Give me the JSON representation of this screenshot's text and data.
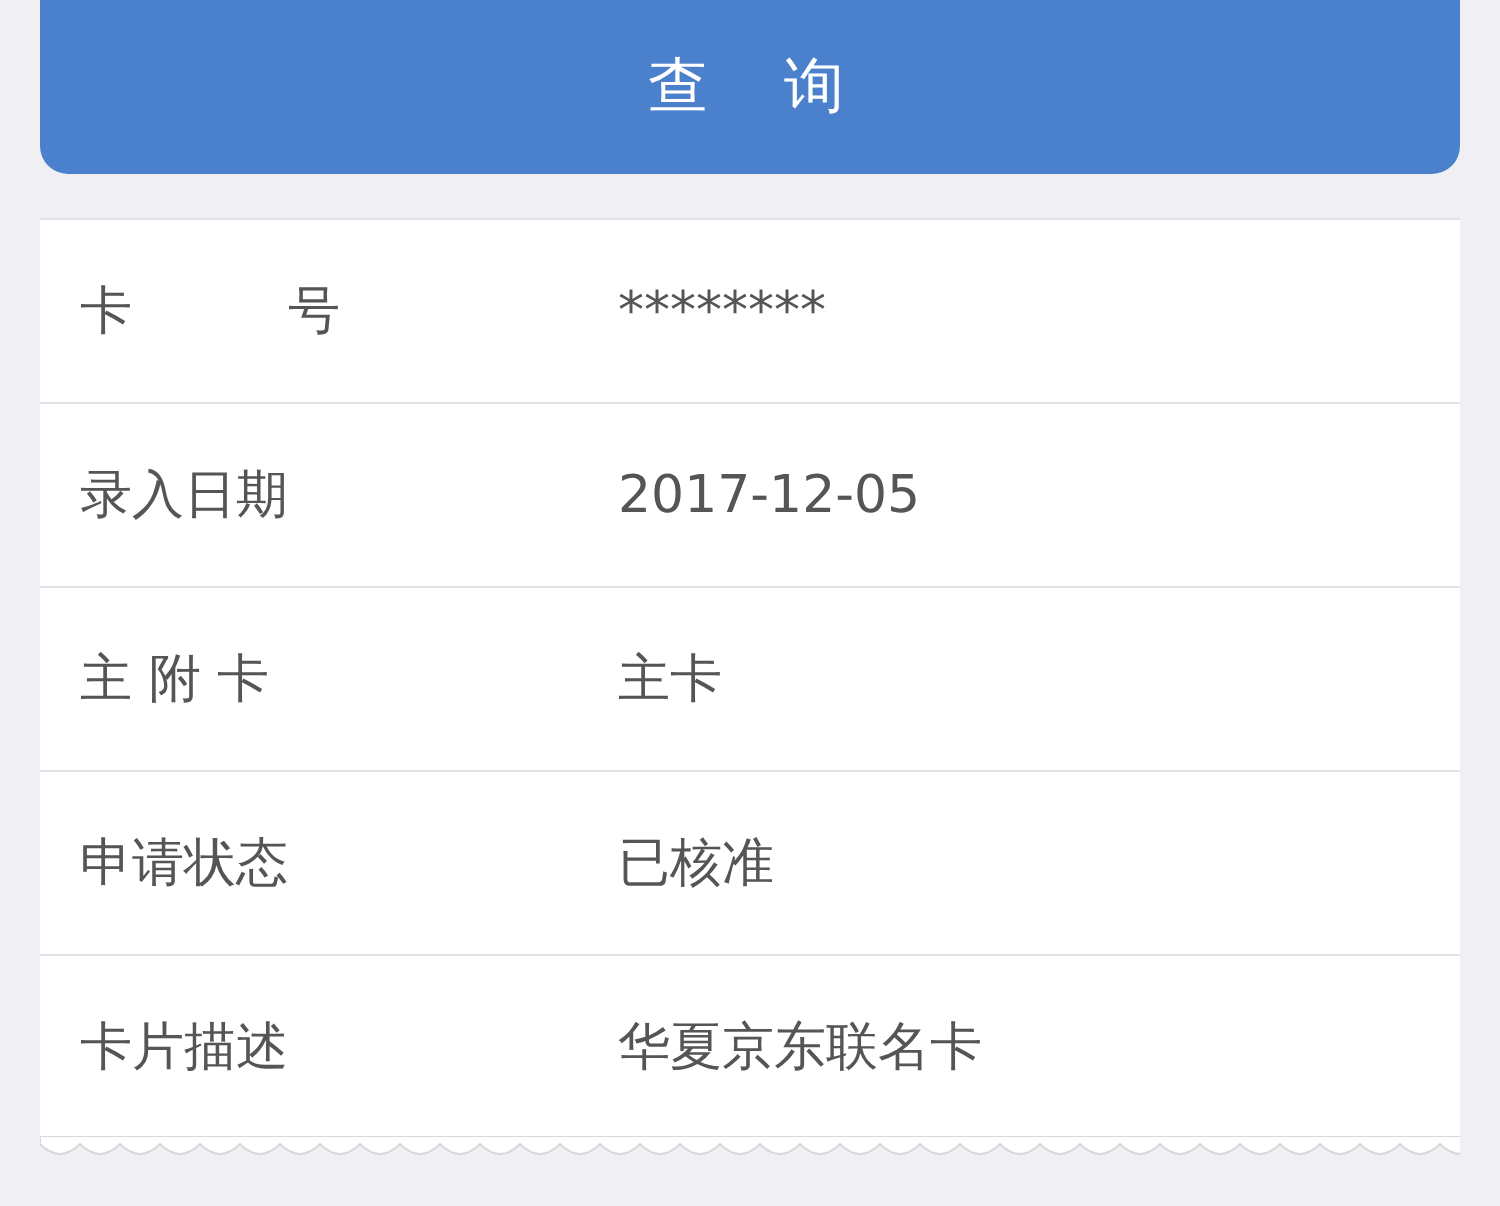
{
  "query_button": {
    "label": "查　询"
  },
  "details": [
    {
      "label": "卡　　　号",
      "value": "********"
    },
    {
      "label": "录入日期",
      "value": "2017-12-05"
    },
    {
      "label": "主 附 卡",
      "value": "主卡"
    },
    {
      "label": "申请状态",
      "value": "已核准"
    },
    {
      "label": "卡片描述",
      "value": "华夏京东联名卡"
    }
  ]
}
